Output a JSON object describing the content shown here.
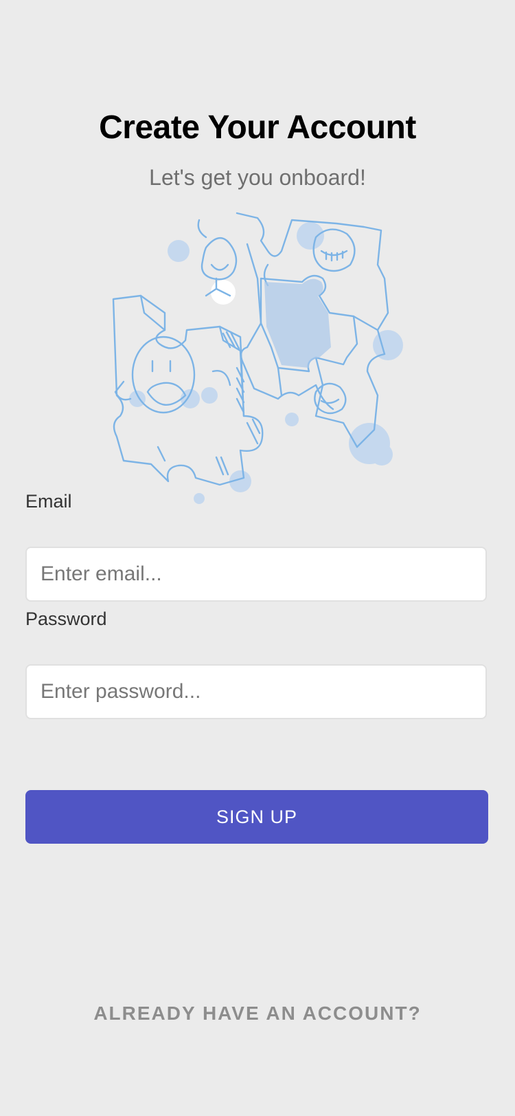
{
  "header": {
    "title": "Create Your Account",
    "subtitle": "Let's get you onboard!"
  },
  "illustration": {
    "icon": "puzzle-people-illustration",
    "color": "#7db4e6"
  },
  "form": {
    "email": {
      "label": "Email",
      "placeholder": "Enter email...",
      "value": ""
    },
    "password": {
      "label": "Password",
      "placeholder": "Enter password...",
      "value": ""
    },
    "submit_label": "SIGN UP"
  },
  "footer": {
    "login_link": "ALREADY HAVE AN ACCOUNT?"
  },
  "colors": {
    "background": "#ebebeb",
    "primary": "#5055c4",
    "muted_text": "#8d8d8d"
  }
}
